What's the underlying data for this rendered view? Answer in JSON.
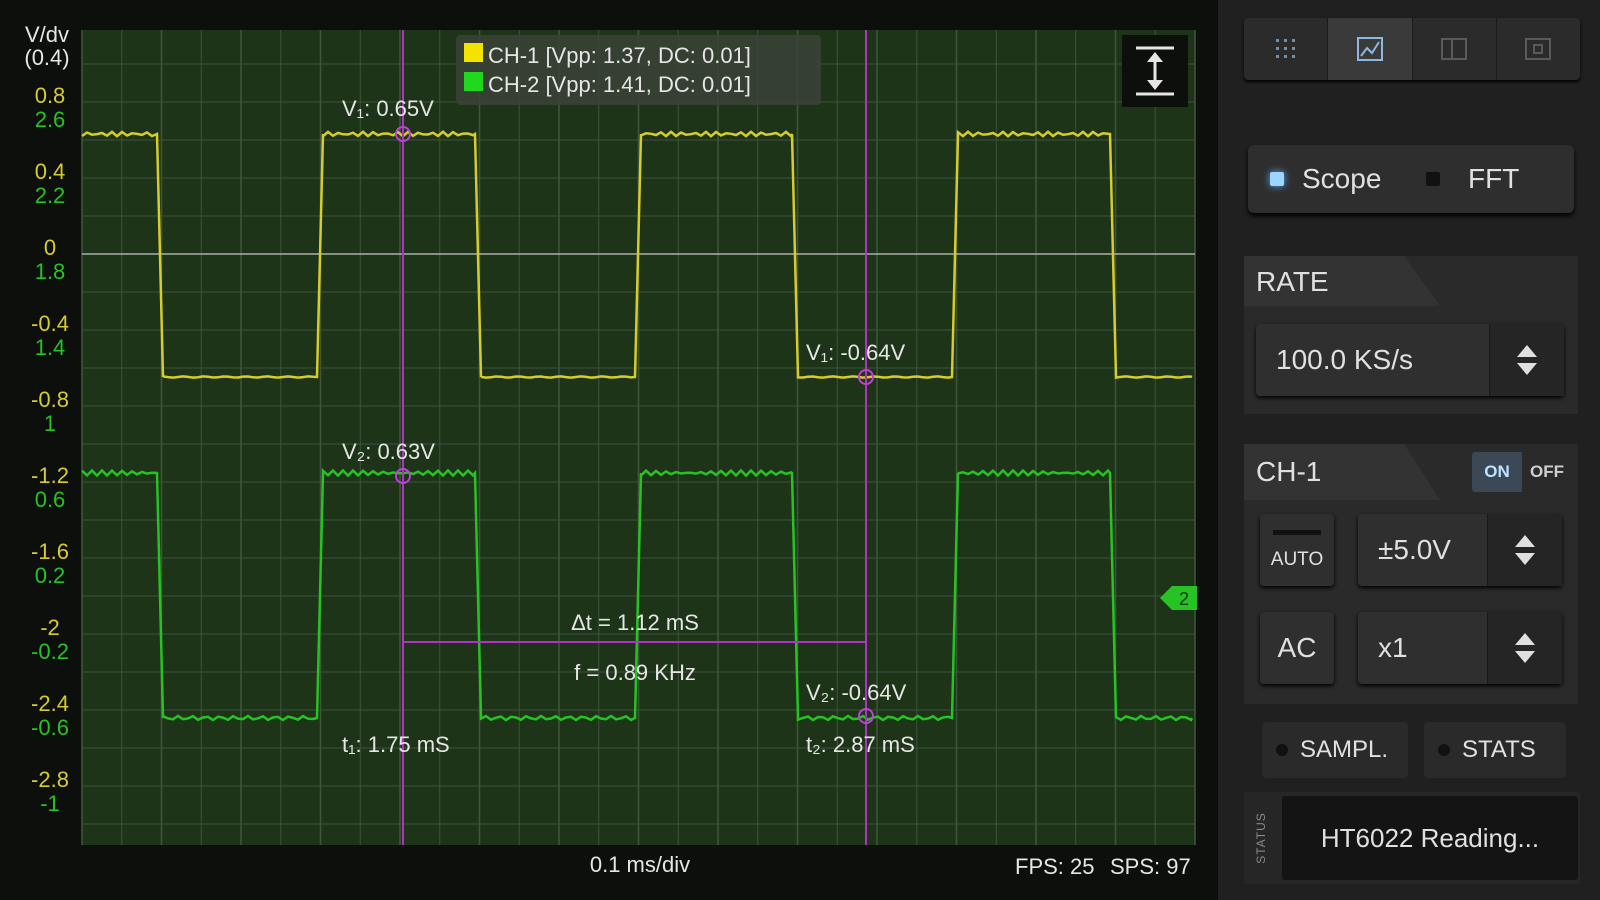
{
  "scope": {
    "yaxis_title": "V/dv",
    "yaxis_scale": "(0.4)",
    "ch1_ticks": [
      "0.8",
      "0.4",
      "0",
      "-0.4",
      "-0.8",
      "-1.2",
      "-1.6",
      "-2",
      "-2.4",
      "-2.8"
    ],
    "ch2_ticks": [
      "2.6",
      "2.2",
      "1.8",
      "1.4",
      "1",
      "0.6",
      "0.2",
      "-0.2",
      "-0.6",
      "-1"
    ],
    "legend": {
      "ch1": "CH-1 [Vpp: 1.37, DC: 0.01]",
      "ch2": "CH-2 [Vpp: 1.41, DC: 0.01]"
    },
    "cursors": {
      "v1a": "V₁: 0.65V",
      "v1b": "V₁: -0.64V",
      "v2a": "V₂: 0.63V",
      "v2b": "V₂: -0.64V",
      "t1": "t₁: 1.75 mS",
      "t2": "t₂: 2.87 mS",
      "dt": "Δt = 1.12 mS",
      "freq": "f = 0.89 KHz"
    },
    "timebase": "0.1 ms/div",
    "fps": "FPS: 25",
    "sps": "SPS: 97",
    "ch2_marker": "2",
    "colors": {
      "ch1": "#d6cc2c",
      "ch2": "#27c223",
      "cursor": "#b033c8",
      "grid": "#3e553a",
      "bg": "#0c0f0b"
    },
    "icons": {
      "vertical_expand": "vertical-expand-icon"
    }
  },
  "panel": {
    "tabs": [
      {
        "icon": "grid-dots-icon",
        "active": false
      },
      {
        "icon": "chart-image-icon",
        "active": true
      },
      {
        "icon": "split-view-icon",
        "active": false
      },
      {
        "icon": "single-view-icon",
        "active": false
      }
    ],
    "mode": {
      "scope": "Scope",
      "fft": "FFT",
      "selected": "Scope"
    },
    "rate": {
      "title": "RATE",
      "value": "100.0 KS/s"
    },
    "ch1": {
      "title": "CH-1",
      "on": "ON",
      "off": "OFF",
      "auto": "AUTO",
      "range": "±5.0V",
      "coupling": "AC",
      "probe": "x1"
    },
    "buttons": {
      "sampl": "SAMPL.",
      "stats": "STATS"
    },
    "status": {
      "tag": "STATUS",
      "text": "HT6022 Reading..."
    }
  }
}
